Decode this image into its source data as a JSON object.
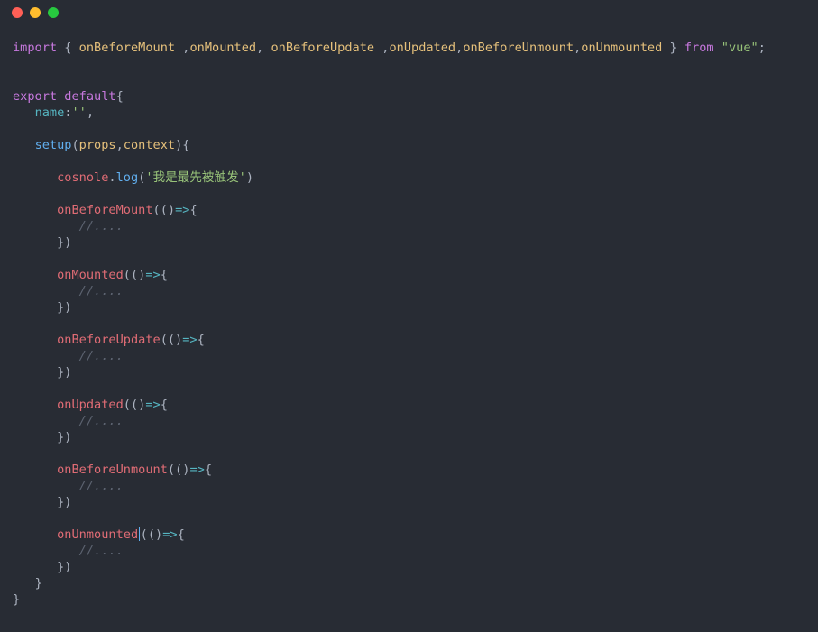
{
  "window": {
    "controls": {
      "close_color": "#ff5f56",
      "minimize_color": "#ffbd2e",
      "maximize_color": "#27c93f"
    }
  },
  "colors": {
    "background": "#282c34",
    "keyword": "#c678dd",
    "import_name": "#e5c07b",
    "string": "#98c379",
    "hook": "#e06c75",
    "method": "#61afef",
    "property": "#56b6c2",
    "comment": "#5c6370",
    "text": "#abb2bf"
  },
  "code": {
    "import_kw": "import",
    "brace_open": "{",
    "brace_close": "}",
    "imports": [
      "onBeforeMount",
      "onMounted",
      "onBeforeUpdate",
      "onUpdated",
      "onBeforeUnmount",
      "onUnmounted"
    ],
    "from_kw": "from",
    "module": "\"vue\"",
    "export_kw": "export",
    "default_kw": "default",
    "name_key": "name",
    "name_value": "''",
    "setup_fn": "setup",
    "param_props": "props",
    "param_context": "context",
    "log_object": "cosnole",
    "log_method": "log",
    "log_message": "'我是最先被触发'",
    "arrow": "=>",
    "comment": "//....",
    "hooks": [
      "onBeforeMount",
      "onMounted",
      "onBeforeUpdate",
      "onUpdated",
      "onBeforeUnmount",
      "onUnmounted"
    ]
  }
}
